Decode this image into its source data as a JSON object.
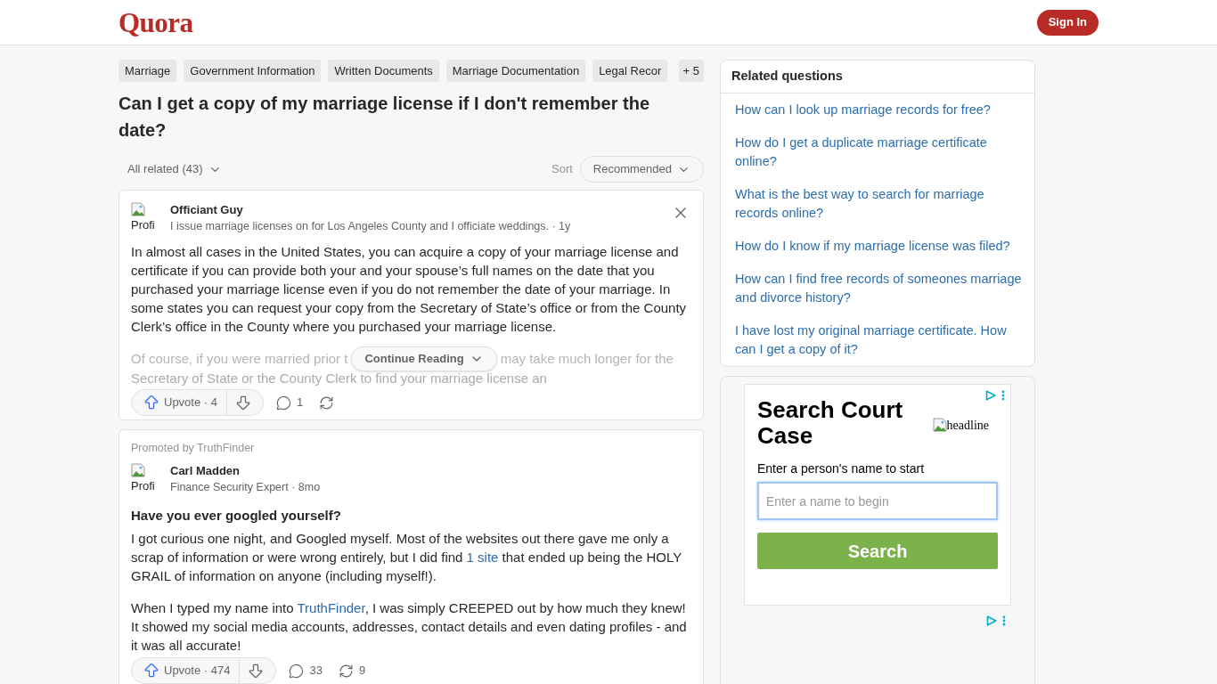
{
  "header": {
    "logo": "Quora",
    "sign_in": "Sign In"
  },
  "question": {
    "topics": [
      "Marriage",
      "Government Information",
      "Written Documents",
      "Marriage Documentation",
      "Legal Recor"
    ],
    "more_topics": "+ 5",
    "title": "Can I get a copy of my marriage license if I don't remember the date?",
    "filter": "All related (43)",
    "sort_label": "Sort",
    "sort_value": "Recommended"
  },
  "answers": [
    {
      "kind": "answer",
      "avatar_alt": "Profi",
      "author": "Officiant Guy",
      "credential": "I issue marriage licenses on for Los Angeles County and I officiate weddings. · 1y",
      "dismissible": true,
      "paragraphs": [
        [
          {
            "text": "In almost all cases in the United States, you can acquire a copy of your marriage license and certificate if you can provide both your and your spouse’s full names on the date that you purchased your marriage license even if you do not remember the date of your marriage. In some states you can request your copy from the Secretary of State’s office or from the County Clerk’s office in the County where you purchased your marriage license.",
            "link": false
          }
        ]
      ],
      "faded": {
        "before": "Of course, if you were married prior t",
        "after": "may take much longer for the",
        "next_line": "Secretary of State or the County Clerk to find your marriage license an"
      },
      "continue_label": "Continue Reading",
      "upvote": "Upvote · 4",
      "comments": "1"
    },
    {
      "kind": "promoted",
      "promoted_by": "Promoted by TruthFinder",
      "avatar_alt": "Profi",
      "author": "Carl Madden",
      "credential": "Finance Security Expert · 8mo",
      "dismissible": false,
      "headline": "Have you ever googled yourself?",
      "paragraphs": [
        [
          {
            "text": "I got curious one night, and Googled myself. Most of the websites out there gave me only a scrap of information or were wrong entirely, but I did find ",
            "link": false
          },
          {
            "text": "1 site",
            "link": true
          },
          {
            "text": " that ended up being the HOLY GRAIL of information on anyone (including myself!).",
            "link": false
          }
        ],
        [
          {
            "text": "When I typed my name into ",
            "link": false
          },
          {
            "text": "TruthFinder",
            "link": true
          },
          {
            "text": ", I was simply CREEPED out by how much they knew! It showed my social media accounts, addresses, contact details and even dating profiles - and it was all accurate!",
            "link": false
          }
        ]
      ],
      "upvote": "Upvote · 474",
      "comments": "33",
      "shares": "9"
    }
  ],
  "related": {
    "title": "Related questions",
    "items": [
      "How can I look up marriage records for free?",
      "How do I get a duplicate marriage certificate online?",
      "What is the best way to search for marriage records online?",
      "How do I know if my marriage license was filed?",
      "How can I find free records of someones marriage and divorce history?",
      "I have lost my original marriage certificate. How can I get a copy of it?"
    ]
  },
  "ad": {
    "headline": "Search Court Case",
    "image_alt": "headline",
    "prompt": "Enter a person's name to start",
    "placeholder": "Enter a name to begin",
    "button": "Search"
  }
}
